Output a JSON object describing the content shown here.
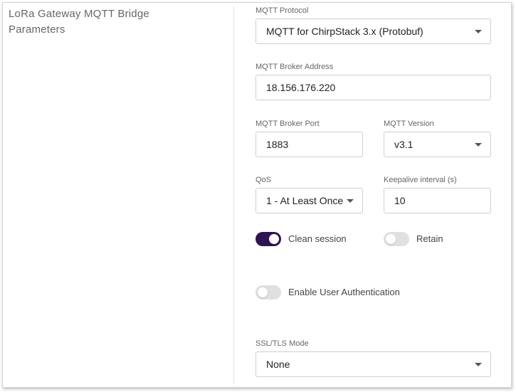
{
  "section": {
    "title_line1": "LoRa Gateway MQTT Bridge",
    "title_line2": "Parameters"
  },
  "mqtt_protocol": {
    "label": "MQTT Protocol",
    "value": "MQTT for ChirpStack 3.x (Protobuf)"
  },
  "broker_address": {
    "label": "MQTT Broker Address",
    "value": "18.156.176.220"
  },
  "broker_port": {
    "label": "MQTT Broker Port",
    "value": "1883"
  },
  "mqtt_version": {
    "label": "MQTT Version",
    "value": "v3.1"
  },
  "qos": {
    "label": "QoS",
    "value": "1 - At Least Once"
  },
  "keepalive": {
    "label": "Keepalive interval (s)",
    "value": "10"
  },
  "clean_session": {
    "label": "Clean session",
    "on": true
  },
  "retain": {
    "label": "Retain",
    "on": false
  },
  "user_auth": {
    "label": "Enable User Authentication",
    "on": false
  },
  "ssl_tls": {
    "label": "SSL/TLS Mode",
    "value": "None"
  },
  "colors": {
    "toggle_on": "#2e1452",
    "toggle_off": "#e0e0e0"
  }
}
